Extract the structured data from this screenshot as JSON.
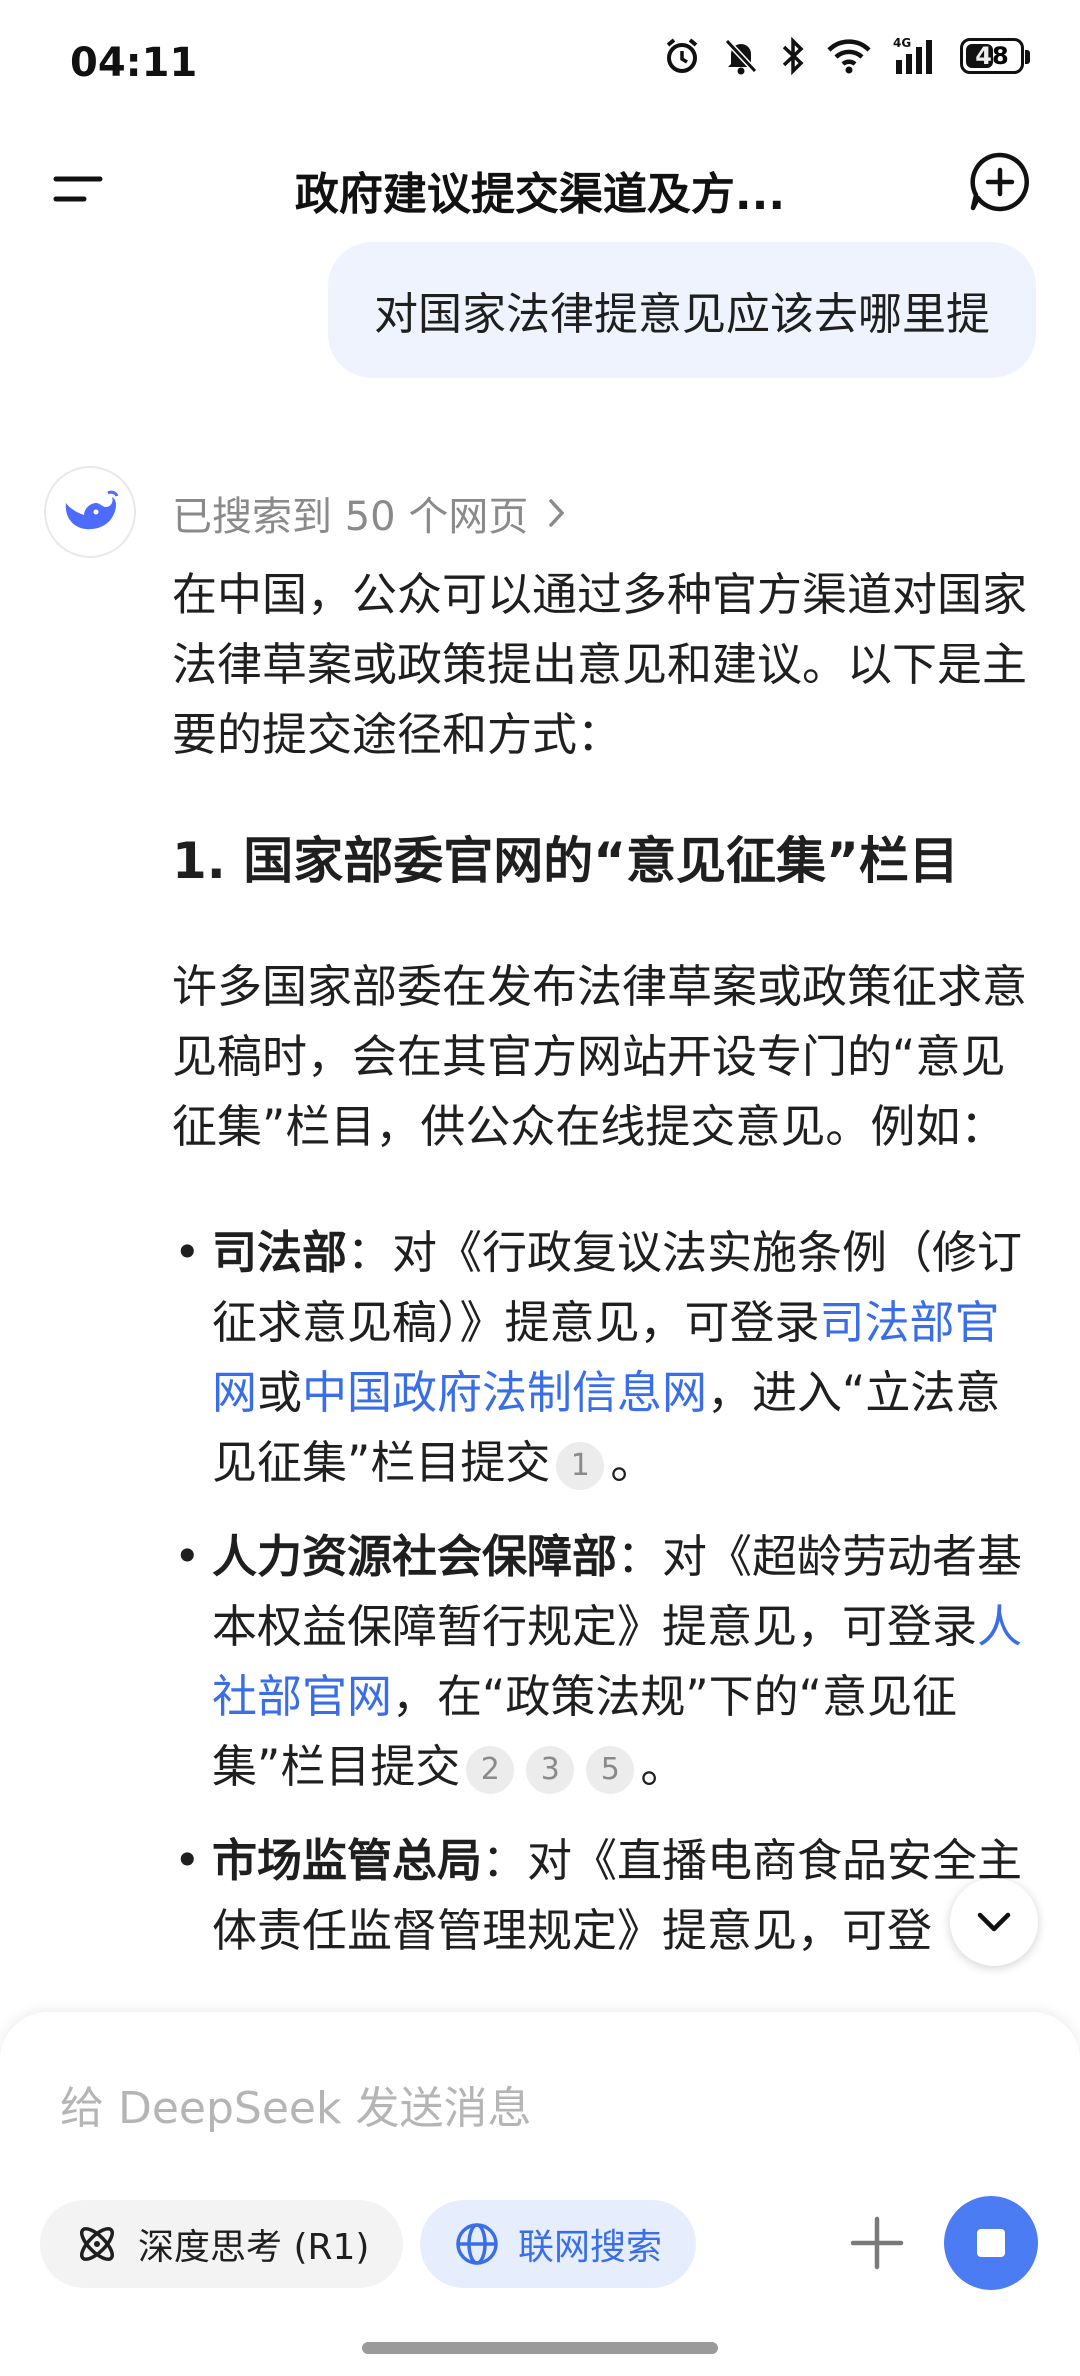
{
  "status_bar": {
    "time": "04:11",
    "battery_level": "48"
  },
  "header": {
    "title": "政府建议提交渠道及方..."
  },
  "user_message": "对国家法律提意见应该去哪里提",
  "assistant": {
    "search_summary": "已搜索到 50 个网页",
    "intro": "在中国，公众可以通过多种官方渠道对国家法律草案或政策提出意见和建议。以下是主要的提交途径和方式：",
    "section1_heading": "1. 国家部委官网的“意见征集”栏目",
    "section1_para": "许多国家部委在发布法律草案或政策征求意见稿时，会在其官方网站开设专门的“意见征集”栏目，供公众在线提交意见。例如：",
    "bullets": [
      {
        "bold": "司法部",
        "t1": "：对《行政复议法实施条例（修订征求意见稿）》提意见，可登录",
        "link1": "司法部官网",
        "t2": "或",
        "link2": "中国政府法制信息网",
        "t3": "，进入“立法意见征集”栏目提交",
        "cites": [
          "1"
        ],
        "end": "。"
      },
      {
        "bold": "人力资源社会保障部",
        "t1": "：对《超龄劳动者基本权益保障暂行规定》提意见，可登录",
        "link1": "人社部官网",
        "t2": "，在“政策法规”下的“意见征集”栏目提交",
        "cites": [
          "2",
          "3",
          "5"
        ],
        "end": "。"
      },
      {
        "bold": "市场监管总局",
        "t1": "：对《直播电商食品安全主体责任监督管理规定》提意见，可登"
      }
    ]
  },
  "composer": {
    "placeholder": "给 DeepSeek 发送消息",
    "deep_think_label": "深度思考 (R1)",
    "web_search_label": "联网搜索"
  },
  "colors": {
    "accent": "#4c7cf3",
    "link": "#3a6ee8",
    "bubble": "#eef3fd"
  }
}
